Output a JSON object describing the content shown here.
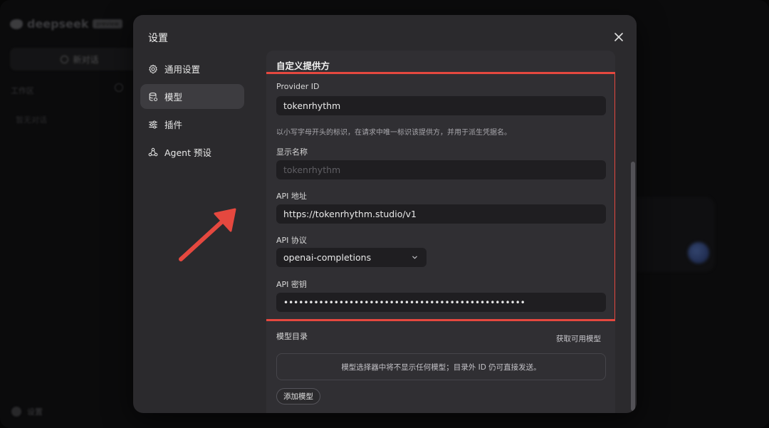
{
  "background": {
    "logo_text": "deepseek",
    "logo_badge": "preview",
    "new_chat_label": "新对话",
    "section_label": "工作区",
    "empty_text": "暂无对话",
    "settings_label": "设置"
  },
  "modal": {
    "title": "设置",
    "close_icon": "close-icon"
  },
  "nav": {
    "items": [
      {
        "label": "通用设置",
        "icon": "gear-icon",
        "active": false
      },
      {
        "label": "模型",
        "icon": "database-icon",
        "active": true
      },
      {
        "label": "插件",
        "icon": "sliders-icon",
        "active": false
      },
      {
        "label": "Agent 预设",
        "icon": "agent-icon",
        "active": false
      }
    ]
  },
  "provider": {
    "section_title": "自定义提供方",
    "provider_id_label": "Provider ID",
    "provider_id_value": "tokenrhythm",
    "provider_id_hint": "以小写字母开头的标识，在请求中唯一标识该提供方，并用于派生凭据名。",
    "display_name_label": "显示名称",
    "display_name_placeholder": "tokenrhythm",
    "api_url_label": "API 地址",
    "api_url_value": "https://tokenrhythm.studio/v1",
    "api_protocol_label": "API 协议",
    "api_protocol_value": "openai-completions",
    "api_key_label": "API 密钥",
    "api_key_value": "••••••••••••••••••••••••••••••••••••••••••••••••"
  },
  "models": {
    "label": "模型目录",
    "fetch_label": "获取可用模型",
    "empty_text": "模型选择器中将不显示任何模型；目录外 ID 仍可直接发送。",
    "add_button_label": "添加模型"
  },
  "colors": {
    "highlight": "#e5483f",
    "modal_bg": "#2b2a2d",
    "input_bg": "#1f1e21"
  }
}
